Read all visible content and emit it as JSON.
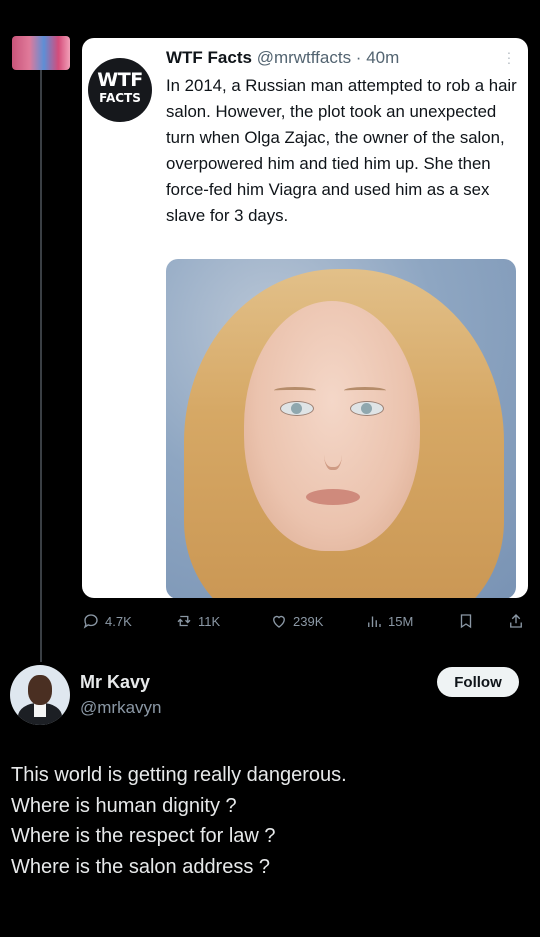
{
  "quoted_tweet": {
    "logo_text_line1": "WTF",
    "logo_text_line2": "FACTS",
    "name": "WTF Facts",
    "handle_time": "@mrwtffacts · 40m",
    "text": "In 2014, a Russian man attempted to rob a hair salon. However, the plot took an unexpected turn when Olga Zajac, the owner of the salon, overpowered him and tied him up. She then force-fed him Viagra and used him as a sex slave for 3 days."
  },
  "actions": {
    "replies": "4.7K",
    "reposts": "11K",
    "likes": "239K",
    "views": "15M"
  },
  "post": {
    "name": "Mr Kavy",
    "handle": "@mrkavyn",
    "follow_label": "Follow",
    "lines": [
      "This world is getting really dangerous.",
      "Where is human dignity ?",
      "Where is the respect for law ?",
      "Where is the salon address ?"
    ]
  },
  "colors": {
    "background": "#000000",
    "card": "#ffffff",
    "muted": "#8b98a5",
    "text": "#e7e9ea"
  }
}
